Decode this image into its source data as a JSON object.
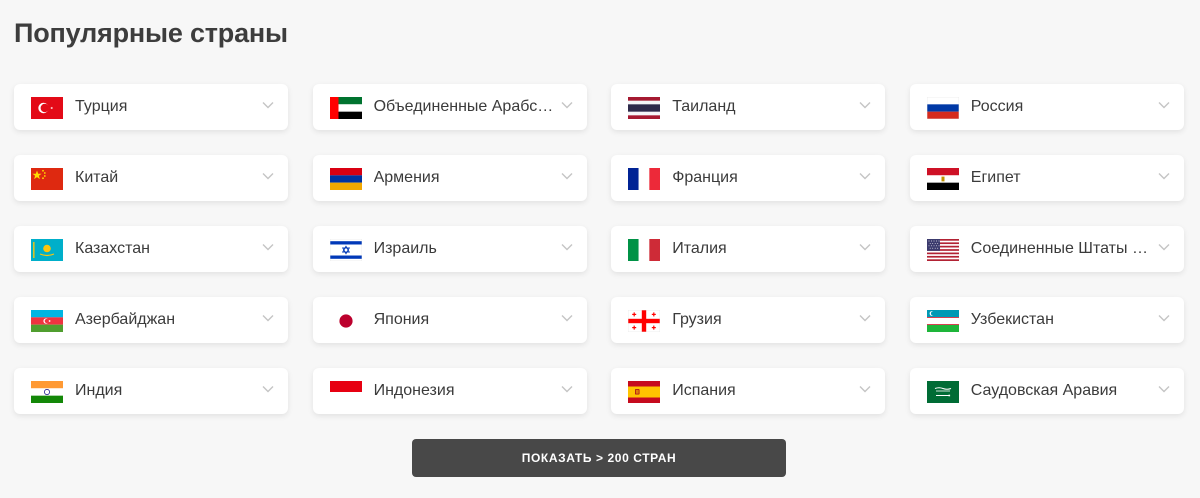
{
  "header": {
    "title": "Популярные страны"
  },
  "countries": [
    {
      "label": "Турция",
      "icon": "turkey-flag-icon"
    },
    {
      "label": "Объединенные Арабские Эмираты",
      "icon": "uae-flag-icon"
    },
    {
      "label": "Таиланд",
      "icon": "thailand-flag-icon"
    },
    {
      "label": "Россия",
      "icon": "russia-flag-icon"
    },
    {
      "label": "Китай",
      "icon": "china-flag-icon"
    },
    {
      "label": "Армения",
      "icon": "armenia-flag-icon"
    },
    {
      "label": "Франция",
      "icon": "france-flag-icon"
    },
    {
      "label": "Египет",
      "icon": "egypt-flag-icon"
    },
    {
      "label": "Казахстан",
      "icon": "kazakhstan-flag-icon"
    },
    {
      "label": "Израиль",
      "icon": "israel-flag-icon"
    },
    {
      "label": "Италия",
      "icon": "italy-flag-icon"
    },
    {
      "label": "Соединенные Штаты Америки",
      "icon": "usa-flag-icon"
    },
    {
      "label": "Азербайджан",
      "icon": "azerbaijan-flag-icon"
    },
    {
      "label": "Япония",
      "icon": "japan-flag-icon"
    },
    {
      "label": "Грузия",
      "icon": "georgia-flag-icon"
    },
    {
      "label": "Узбекистан",
      "icon": "uzbekistan-flag-icon"
    },
    {
      "label": "Индия",
      "icon": "india-flag-icon"
    },
    {
      "label": "Индонезия",
      "icon": "indonesia-flag-icon"
    },
    {
      "label": "Испания",
      "icon": "spain-flag-icon"
    },
    {
      "label": "Саудовская Аравия",
      "icon": "saudi-arabia-flag-icon"
    }
  ],
  "footer": {
    "show_more_label": "ПОКАЗАТЬ > 200 СТРАН"
  },
  "colors": {
    "button_bg": "#484848",
    "card_bg": "#ffffff",
    "page_bg": "#f7f7f7",
    "title_color": "#3d3d3d"
  }
}
